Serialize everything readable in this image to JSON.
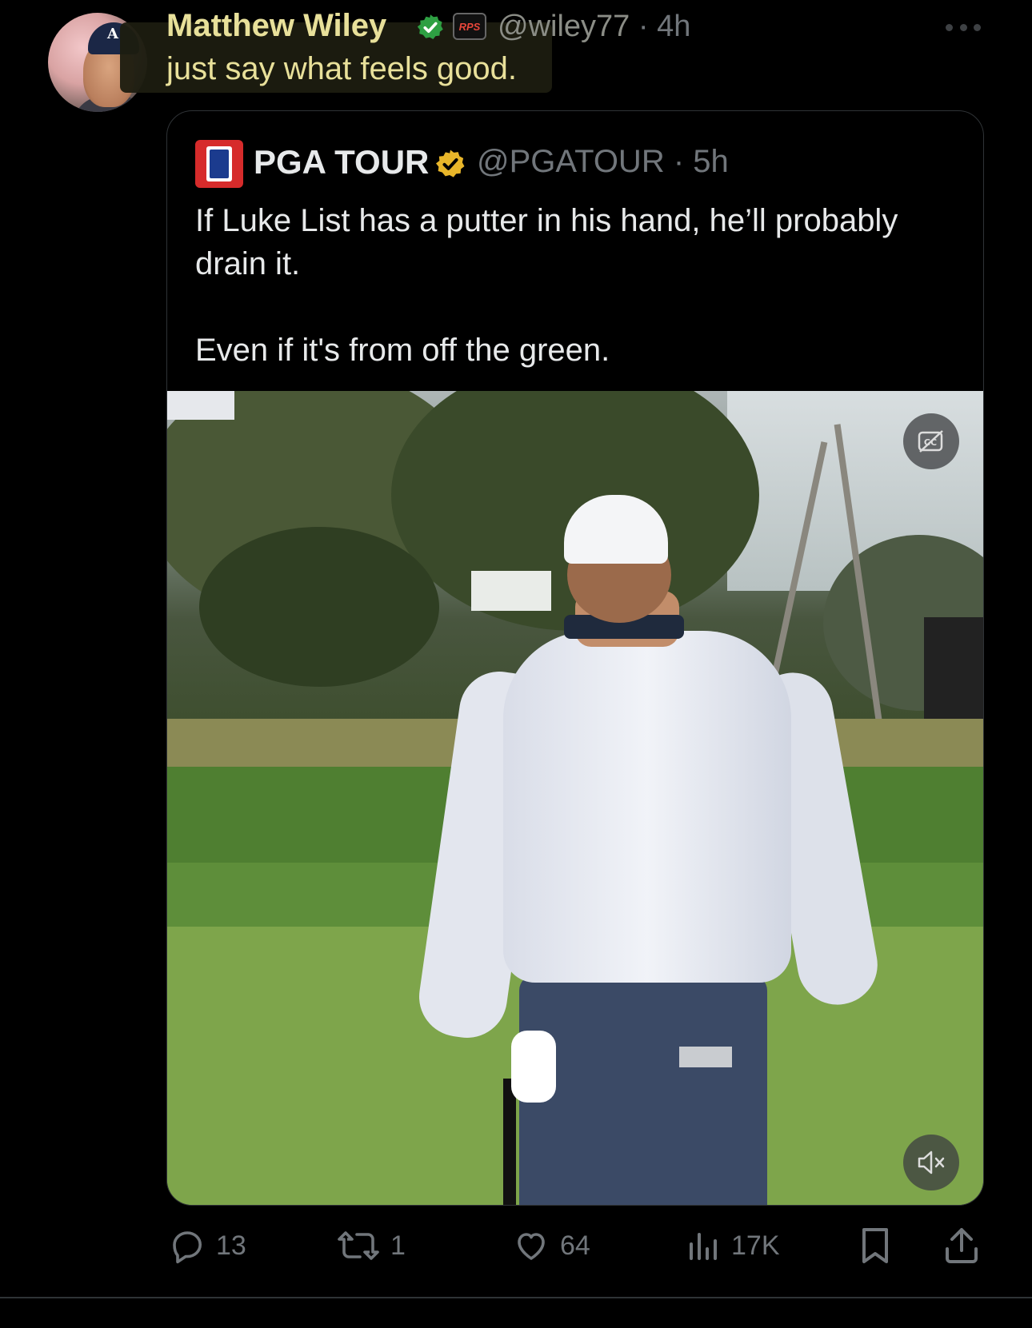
{
  "post": {
    "author": {
      "name": "Matthew Wiley",
      "handle": "@wiley77",
      "time": "4h",
      "affiliation_badge": "RPS",
      "verified": true,
      "avatar": "avatar"
    },
    "text": "just say what feels good.",
    "more_icon": "more-icon"
  },
  "quoted": {
    "author": {
      "name": "PGA TOUR",
      "handle": "@PGATOUR",
      "time": "5h",
      "verified_color": "#e8b62a",
      "logo": "pga-tour-logo"
    },
    "text": [
      "If Luke List has a putter in his hand, he’ll probably drain it.",
      "Even if it's from off the green."
    ],
    "video": {
      "cc_icon": "captions-off-icon",
      "mute_icon": "volume-muted-icon"
    }
  },
  "actions": {
    "replies": "13",
    "reposts": "1",
    "likes": "64",
    "views": "17K"
  },
  "colors": {
    "background": "#000000",
    "text": "#e7e9ea",
    "muted": "#71767b",
    "highlight": "#e8e09a",
    "verified_blue": "#1d9bf0",
    "verified_gold": "#e8b62a"
  }
}
